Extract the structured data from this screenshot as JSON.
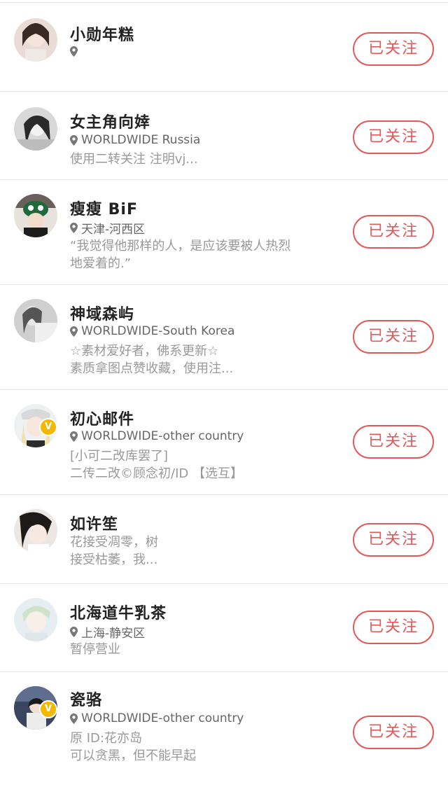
{
  "follow_label": "已关注",
  "users": [
    {
      "name": "小勋年糕",
      "location": "",
      "desc": ""
    },
    {
      "name": "女主角向婞",
      "location": "WORLDWIDE Russia",
      "desc": "使用二转关注 注明vj..."
    },
    {
      "name": "瘦瘦 BiF",
      "location": "天津-河西区",
      "desc": "“我觉得他那样的人，是应该要被人热烈\n地爱着的.”"
    },
    {
      "name": "神域森屿",
      "location": "WORLDWIDE-South Korea",
      "desc": "☆素材爱好者，佛系更新☆\n素质拿图点赞收藏，使用注..."
    },
    {
      "name": "初心邮件",
      "location": "WORLDWIDE-other country",
      "desc": "[小可二改库罢了]\n 二传二改©顾念初/ID 【选互】"
    },
    {
      "name": "如许笙",
      "location": "",
      "desc": "花接受凋零，树\n接受枯萎，我..."
    },
    {
      "name": "北海道牛乳茶",
      "location": "上海-静安区",
      "desc": "暂停营业"
    },
    {
      "name": "瓷骆",
      "location": "WORLDWIDE-other country",
      "desc": "原 ID:花亦岛\n可以贪黑，但不能早起"
    }
  ]
}
